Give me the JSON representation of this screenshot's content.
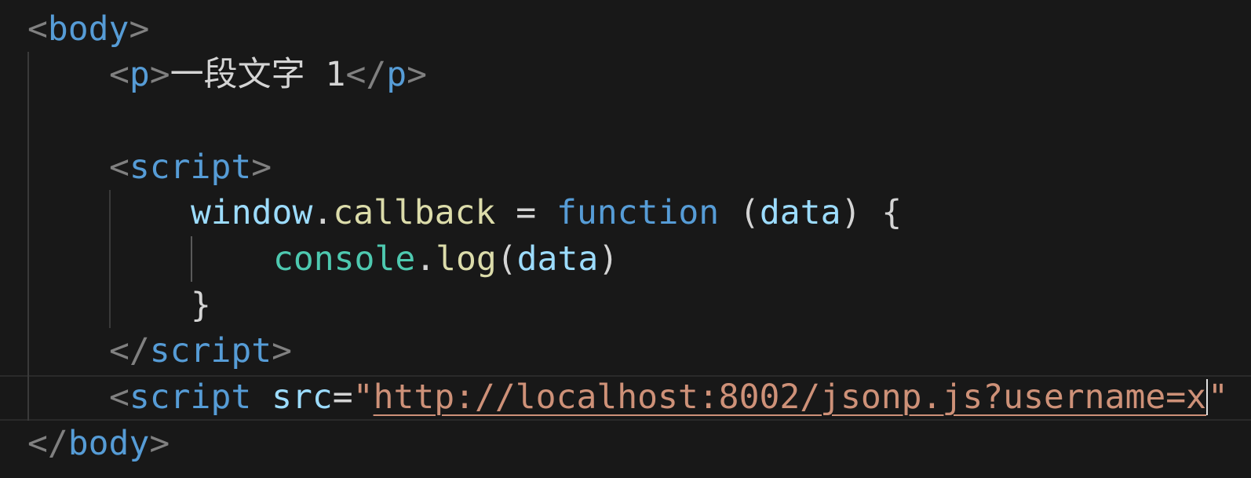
{
  "editor": {
    "lines": [
      {
        "bracket_open": "<",
        "tag": "body",
        "bracket_close": ">"
      },
      {
        "open_lt": "<",
        "open_tag": "p",
        "open_gt": ">",
        "text": "一段文字 1",
        "close_lt": "</",
        "close_tag": "p",
        "close_gt": ">"
      },
      {},
      {
        "bracket_open": "<",
        "tag": "script",
        "bracket_close": ">"
      },
      {
        "obj": "window",
        "dot": ".",
        "prop": "callback",
        "eq": " = ",
        "keyword": "function",
        "paren_open": " (",
        "param": "data",
        "paren_close": ")",
        "brace": " {"
      },
      {
        "obj": "console",
        "dot": ".",
        "method": "log",
        "paren_open": "(",
        "arg": "data",
        "paren_close": ")"
      },
      {
        "brace": "}"
      },
      {
        "bracket_open": "</",
        "tag": "script",
        "bracket_close": ">"
      },
      {
        "bracket_open": "<",
        "tag": "script",
        "space": " ",
        "attr": "src",
        "eq": "=",
        "quote_open": "\"",
        "url": "http://localhost:8002/jsonp.js?username=x",
        "quote_close": "\""
      },
      {
        "bracket_open": "</",
        "tag": "body",
        "bracket_close": ">"
      }
    ]
  },
  "colors": {
    "background": "#181818",
    "bracket": "#808080",
    "tag": "#569cd6",
    "variable": "#9cdcfe",
    "function": "#dcdcaa",
    "class": "#4ec9b0",
    "string": "#ce9178"
  }
}
